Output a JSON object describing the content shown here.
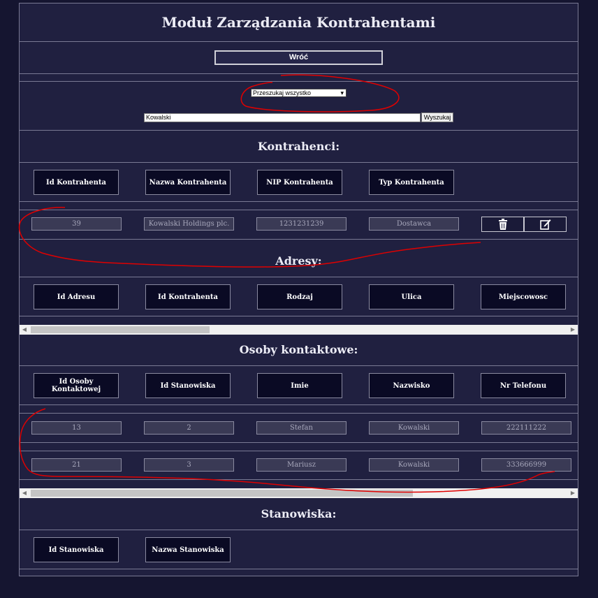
{
  "page": {
    "title": "Moduł Zarządzania Kontrahentami"
  },
  "nav": {
    "back_label": "Wróć"
  },
  "search": {
    "scope_selected": "Przeszukaj wszystko",
    "query": "Kowalski",
    "button_label": "Wyszukaj"
  },
  "kontrahenci": {
    "title": "Kontrahenci:",
    "headers": [
      "Id Kontrahenta",
      "Nazwa Kontrahenta",
      "NIP Kontrahenta",
      "Typ Kontrahenta"
    ],
    "rows": [
      [
        "39",
        "Kowalski Holdings plc.",
        "1231231239",
        "Dostawca"
      ]
    ],
    "row_actions": {
      "delete_icon": "trash-icon",
      "edit_icon": "edit-icon"
    }
  },
  "adresy": {
    "title": "Adresy:",
    "headers": [
      "Id Adresu",
      "Id Kontrahenta",
      "Rodzaj",
      "Ulica",
      "Miejscowosc"
    ]
  },
  "osoby": {
    "title": "Osoby kontaktowe:",
    "headers": [
      "Id Osoby Kontaktowej",
      "Id Stanowiska",
      "Imie",
      "Nazwisko",
      "Nr Telefonu"
    ],
    "rows": [
      [
        "13",
        "2",
        "Stefan",
        "Kowalski",
        "222111222"
      ],
      [
        "21",
        "3",
        "Mariusz",
        "Kowalski",
        "333666999"
      ]
    ]
  },
  "stanowiska": {
    "title": "Stanowiska:",
    "headers": [
      "Id Stanowiska",
      "Nazwa Stanowiska"
    ]
  },
  "colors": {
    "background": "#151530",
    "panel": "#202040",
    "header_cell": "#0a0a24",
    "annotation": "#e00000"
  }
}
